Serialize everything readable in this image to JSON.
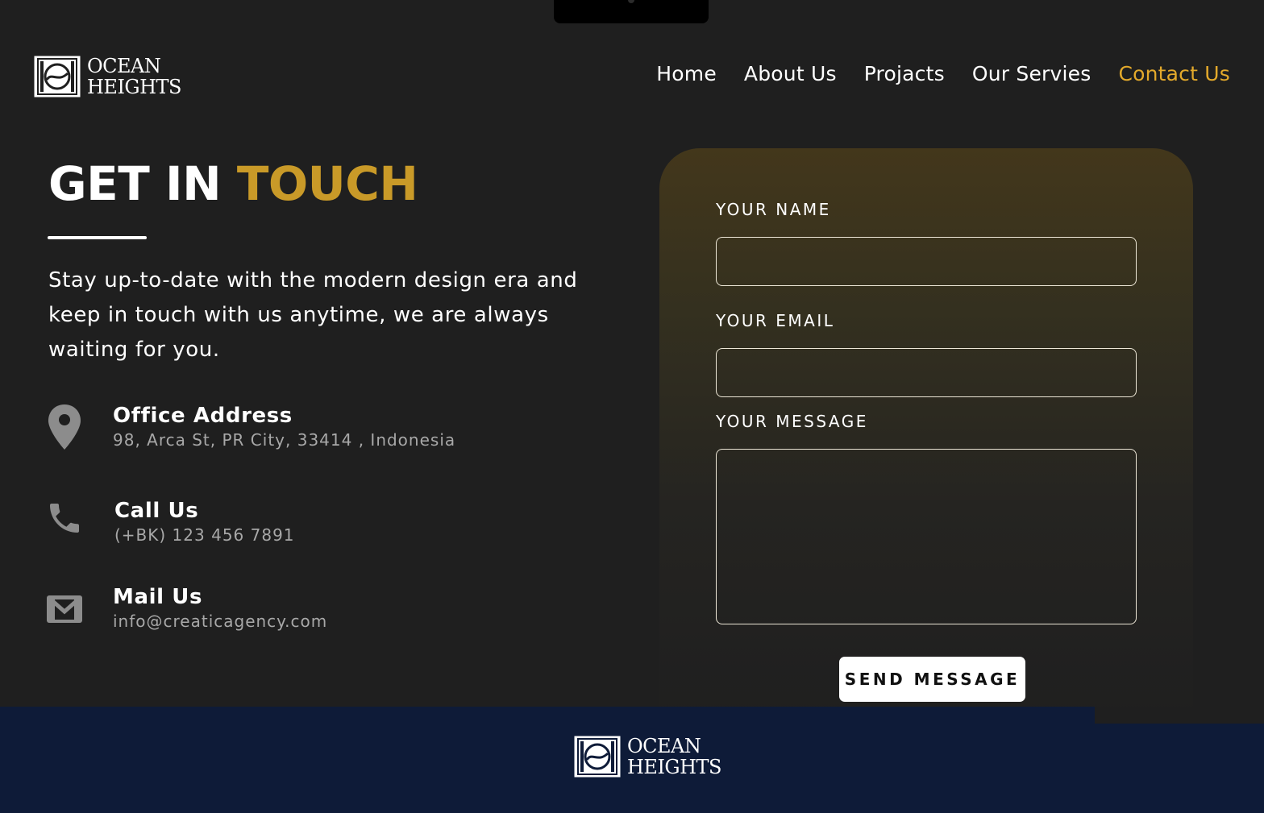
{
  "brand": {
    "line1": "OCEAN",
    "line2": "HEIGHTS"
  },
  "nav": {
    "items": [
      {
        "label": "Home",
        "active": false
      },
      {
        "label": "About Us",
        "active": false
      },
      {
        "label": "Projacts",
        "active": false
      },
      {
        "label": "Our Servies",
        "active": false
      },
      {
        "label": "Contact Us",
        "active": true
      }
    ]
  },
  "hero": {
    "title_part1": "GET IN",
    "title_part2": "TOUCH",
    "intro": "Stay up-to-date with the modern design era and keep in touch with us anytime, we are always waiting for you."
  },
  "contacts": [
    {
      "icon": "location-pin-icon",
      "title": "Office Address",
      "value": "98, Arca St, PR City, 33414 , Indonesia"
    },
    {
      "icon": "phone-icon",
      "title": "Call Us",
      "value": "(+BK) 123 456 7891"
    },
    {
      "icon": "mail-icon",
      "title": "Mail Us",
      "value": "info@creaticagency.com"
    }
  ],
  "form": {
    "name_label": "YOUR NAME",
    "name_value": "",
    "email_label": "YOUR EMAIL",
    "email_value": "",
    "message_label": "YOUR MESSAGE",
    "message_value": "",
    "submit_label": "SEND MESSAGE"
  },
  "colors": {
    "background": "#1f1f1f",
    "accent_gold": "#c99a28",
    "nav_active": "#e3a92b",
    "footer": "#0e1b38"
  }
}
